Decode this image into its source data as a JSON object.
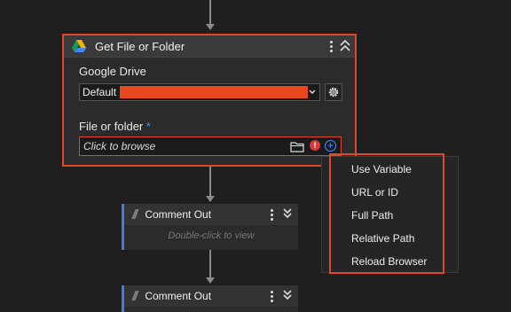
{
  "main_block": {
    "title": "Get File or Folder",
    "service_label": "Google Drive",
    "account_value": "Default",
    "file_label": "File or folder",
    "required_marker": "*",
    "browse_placeholder": "Click to browse",
    "error_symbol": "!"
  },
  "comment_blocks": [
    {
      "title": "Comment Out",
      "hint": "Double-click to view"
    },
    {
      "title": "Comment Out"
    }
  ],
  "menu": {
    "items": [
      "Use Variable",
      "URL or ID",
      "Full Path",
      "Relative Path",
      "Reload Browser"
    ]
  },
  "colors": {
    "background": "#1f1f1f",
    "highlight": "#e0482a",
    "accent": "#4d8dff",
    "error": "#d63b3b"
  },
  "icons": [
    "google-drive-icon",
    "kebab-menu-icon",
    "collapse-icon",
    "chevron-down-icon",
    "gear-icon",
    "folder-icon",
    "error-icon",
    "add-circle-icon",
    "comment-slashes-icon",
    "expand-chevron-icon"
  ]
}
